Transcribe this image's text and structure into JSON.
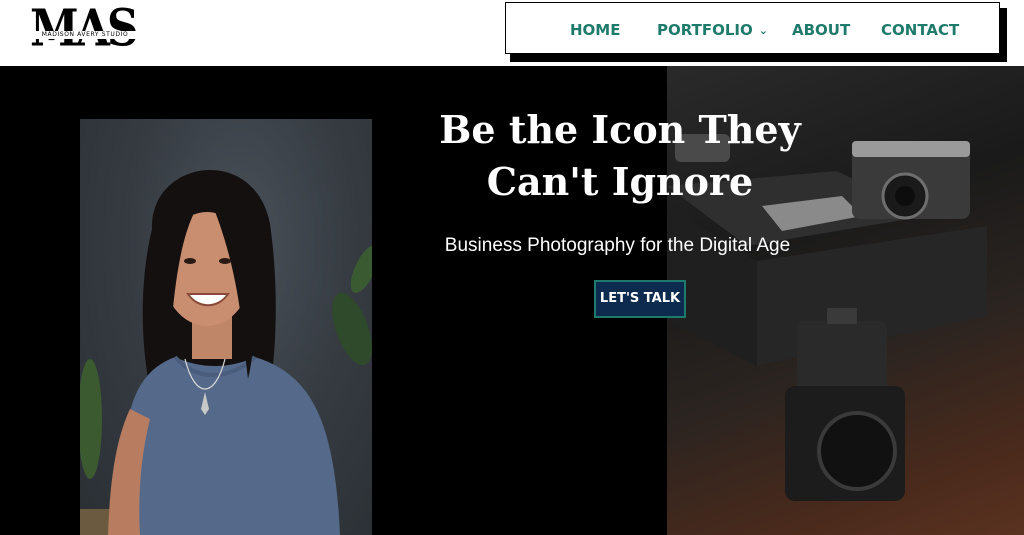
{
  "logo": {
    "wordmark": "MAS",
    "tagline": "MADISON AVERY STUDIO"
  },
  "nav": {
    "items": [
      {
        "label": "HOME"
      },
      {
        "label": "PORTFOLIO",
        "has_dropdown": true,
        "icon": "chevron-down-icon"
      },
      {
        "label": "ABOUT"
      },
      {
        "label": "CONTACT"
      }
    ],
    "color": "#1e7a6a"
  },
  "hero": {
    "title": "Be the Icon They Can't Ignore",
    "subtitle": "Business Photography for the Digital Age",
    "cta_label": "LET'S TALK",
    "cta_color": "#0d2a4f",
    "background": "#000000"
  }
}
